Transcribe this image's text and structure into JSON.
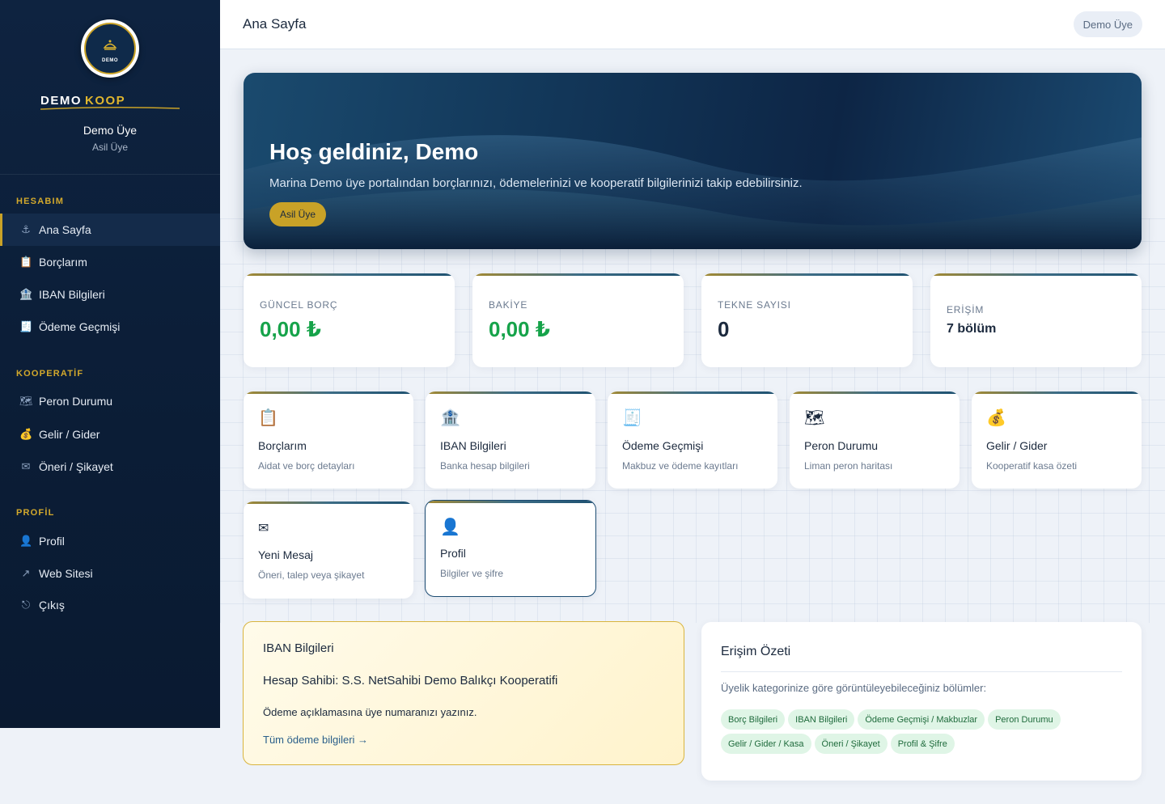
{
  "topbar": {
    "title": "Ana Sayfa",
    "user": "Demo Üye"
  },
  "sidebar": {
    "logo_text": "DEMO",
    "brand_word1": "DEMO",
    "brand_word2": "KOOP",
    "user_name": "Demo Üye",
    "user_role": "Asil Üye",
    "sections": [
      {
        "label": "HESABIM",
        "items": [
          {
            "label": "Ana Sayfa",
            "icon": "anchor-icon",
            "glyph": "⚓"
          },
          {
            "label": "Borçlarım",
            "icon": "clipboard-icon",
            "glyph": "📋"
          },
          {
            "label": "IBAN Bilgileri",
            "icon": "bank-icon",
            "glyph": "🏦"
          },
          {
            "label": "Ödeme Geçmişi",
            "icon": "receipt-icon",
            "glyph": "🧾"
          }
        ]
      },
      {
        "label": "KOOPERATİF",
        "items": [
          {
            "label": "Peron Durumu",
            "icon": "map-icon",
            "glyph": "🗺"
          },
          {
            "label": "Gelir / Gider",
            "icon": "money-bag-icon",
            "glyph": "💰"
          },
          {
            "label": "Öneri / Şikayet",
            "icon": "envelope-icon",
            "glyph": "✉"
          }
        ]
      },
      {
        "label": "PROFİL",
        "items": [
          {
            "label": "Profil",
            "icon": "user-icon",
            "glyph": "👤"
          },
          {
            "label": "Web Sitesi",
            "icon": "external-link-icon",
            "glyph": "↗"
          },
          {
            "label": "Çıkış",
            "icon": "logout-icon",
            "glyph": "⎋"
          }
        ]
      }
    ]
  },
  "hero": {
    "title": "Hoş geldiniz, Demo",
    "subtitle": "Marina Demo üye portalından borçlarınızı, ödemelerinizi ve kooperatif bilgilerinizi takip edebilirsiniz.",
    "badge": "Asil Üye"
  },
  "stats": [
    {
      "label": "GÜNCEL BORÇ",
      "value": "0,00 ₺"
    },
    {
      "label": "BAKİYE",
      "value": "0,00 ₺"
    },
    {
      "label": "TEKNE SAYISI",
      "value": "0"
    },
    {
      "label": "ERİŞİM",
      "value": "7 bölüm"
    }
  ],
  "tiles": [
    {
      "title": "Borçlarım",
      "desc": "Aidat ve borç detayları",
      "icon": "clipboard-icon",
      "glyph": "📋"
    },
    {
      "title": "IBAN Bilgileri",
      "desc": "Banka hesap bilgileri",
      "icon": "bank-icon",
      "glyph": "🏦"
    },
    {
      "title": "Ödeme Geçmişi",
      "desc": "Makbuz ve ödeme kayıtları",
      "icon": "receipt-icon",
      "glyph": "🧾"
    },
    {
      "title": "Peron Durumu",
      "desc": "Liman peron haritası",
      "icon": "map-icon",
      "glyph": "🗺"
    },
    {
      "title": "Gelir / Gider",
      "desc": "Kooperatif kasa özeti",
      "icon": "money-bag-icon",
      "glyph": "💰"
    },
    {
      "title": "Yeni Mesaj",
      "desc": "Öneri, talep veya şikayet",
      "icon": "envelope-icon",
      "glyph": "✉"
    },
    {
      "title": "Profil",
      "desc": "Bilgiler ve şifre",
      "icon": "user-icon",
      "glyph": "👤"
    }
  ],
  "iban": {
    "title": "IBAN Bilgileri",
    "holder": "Hesap Sahibi: S.S. NetSahibi Demo Balıkçı Kooperatifi",
    "note": "Ödeme açıklamasına üye numaranızı yazınız.",
    "link": "Tüm ödeme bilgileri →"
  },
  "access": {
    "title": "Erişim Özeti",
    "description": "Üyelik kategorinize göre görüntüleyebileceğiniz bölümler:",
    "chips": [
      "Borç Bilgileri",
      "IBAN Bilgileri",
      "Ödeme Geçmişi / Makbuzlar",
      "Peron Durumu",
      "Gelir / Gider / Kasa",
      "Öneri / Şikayet",
      "Profil & Şifre"
    ]
  },
  "colors": {
    "sidebar": "#0e2340",
    "accent_gold": "#c9a227",
    "money_green": "#16a34a",
    "chip_bg": "#dff5e6"
  }
}
